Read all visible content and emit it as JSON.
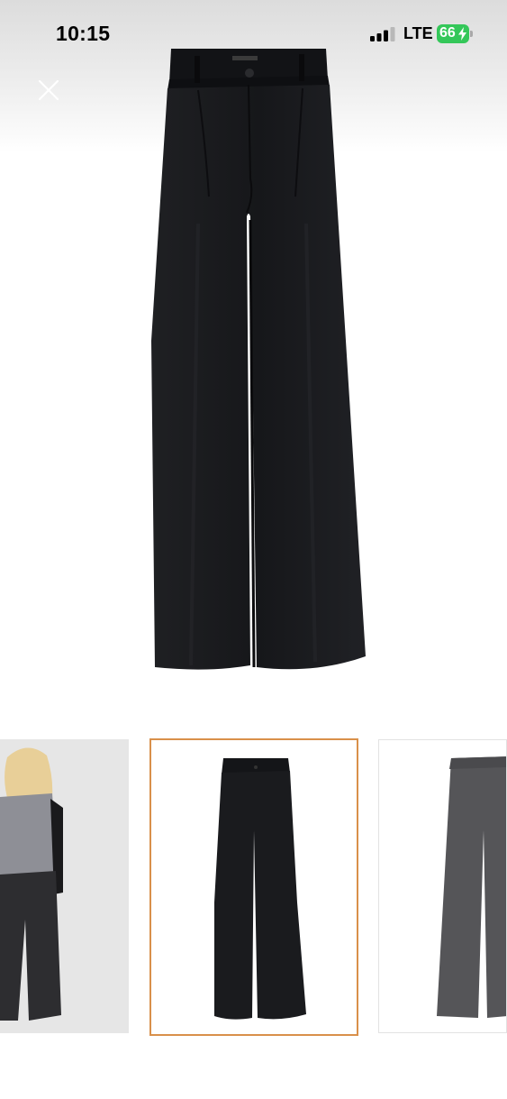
{
  "status_bar": {
    "time": "10:15",
    "network": "LTE",
    "battery_level": "66",
    "battery_color": "#34c759"
  },
  "icons": {
    "close": "close-icon",
    "signal": "signal-bars-icon",
    "battery": "battery-charging-icon"
  },
  "gallery": {
    "selected_index": 1,
    "thumbnail_count": 3,
    "selected_border_color": "#d9904a"
  }
}
